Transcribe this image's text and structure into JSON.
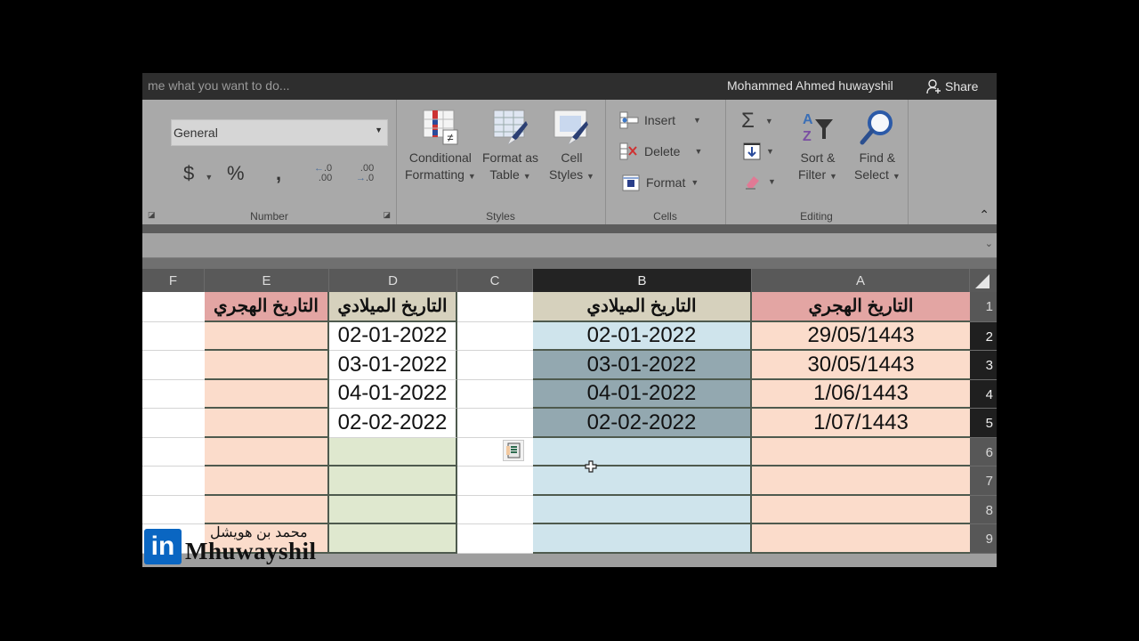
{
  "titlebar": {
    "tell_me": "me what you want to do...",
    "user_name": "Mohammed Ahmed huwayshil",
    "share_label": "Share"
  },
  "ribbon": {
    "number": {
      "format_value": "General",
      "currency_symbol": "$",
      "percent_symbol": "%",
      "comma_symbol": ",",
      "increase_decimal": [
        ".0",
        ".00"
      ],
      "decrease_decimal": [
        ".00",
        ".0"
      ],
      "label": "Number"
    },
    "styles": {
      "conditional_formatting": [
        "Conditional",
        "Formatting"
      ],
      "format_as_table": [
        "Format as",
        "Table"
      ],
      "cell_styles": [
        "Cell",
        "Styles"
      ],
      "label": "Styles"
    },
    "cells": {
      "insert": "Insert",
      "delete": "Delete",
      "format": "Format",
      "label": "Cells"
    },
    "editing": {
      "sort_filter": [
        "Sort &",
        "Filter"
      ],
      "find_select": [
        "Find &",
        "Select"
      ],
      "label": "Editing"
    }
  },
  "grid": {
    "columns": [
      "F",
      "E",
      "D",
      "C",
      "B",
      "A"
    ],
    "selected_column": "B",
    "rows": [
      "1",
      "2",
      "3",
      "4",
      "5",
      "6",
      "7",
      "8",
      "9"
    ],
    "selected_rows": [
      "2",
      "3",
      "4",
      "5"
    ],
    "headers": {
      "A": "التاريخ الهجري",
      "B": "التاريخ الميلادي",
      "D": "التاريخ الميلادي",
      "E": "التاريخ الهجري"
    },
    "col_A": [
      "29/05/1443",
      "30/05/1443",
      "1/06/1443",
      "1/07/1443"
    ],
    "col_B": [
      "02-01-2022",
      "03-01-2022",
      "04-01-2022",
      "02-02-2022"
    ],
    "col_D": [
      "02-01-2022",
      "03-01-2022",
      "04-01-2022",
      "02-02-2022"
    ],
    "colors": {
      "hijri_header": "#e3a5a3",
      "hijri_fill": "#fbdccb",
      "gregorian_header": "#d6d1bd",
      "col_D_fill": "#dfe8cf",
      "col_B_fill": "#cfe4ec",
      "col_B_selected": "#93a8b0"
    }
  },
  "watermark": {
    "logo": "in",
    "arabic_name": "محمد بن هويشل",
    "latin_name": "Mhuwayshil"
  }
}
